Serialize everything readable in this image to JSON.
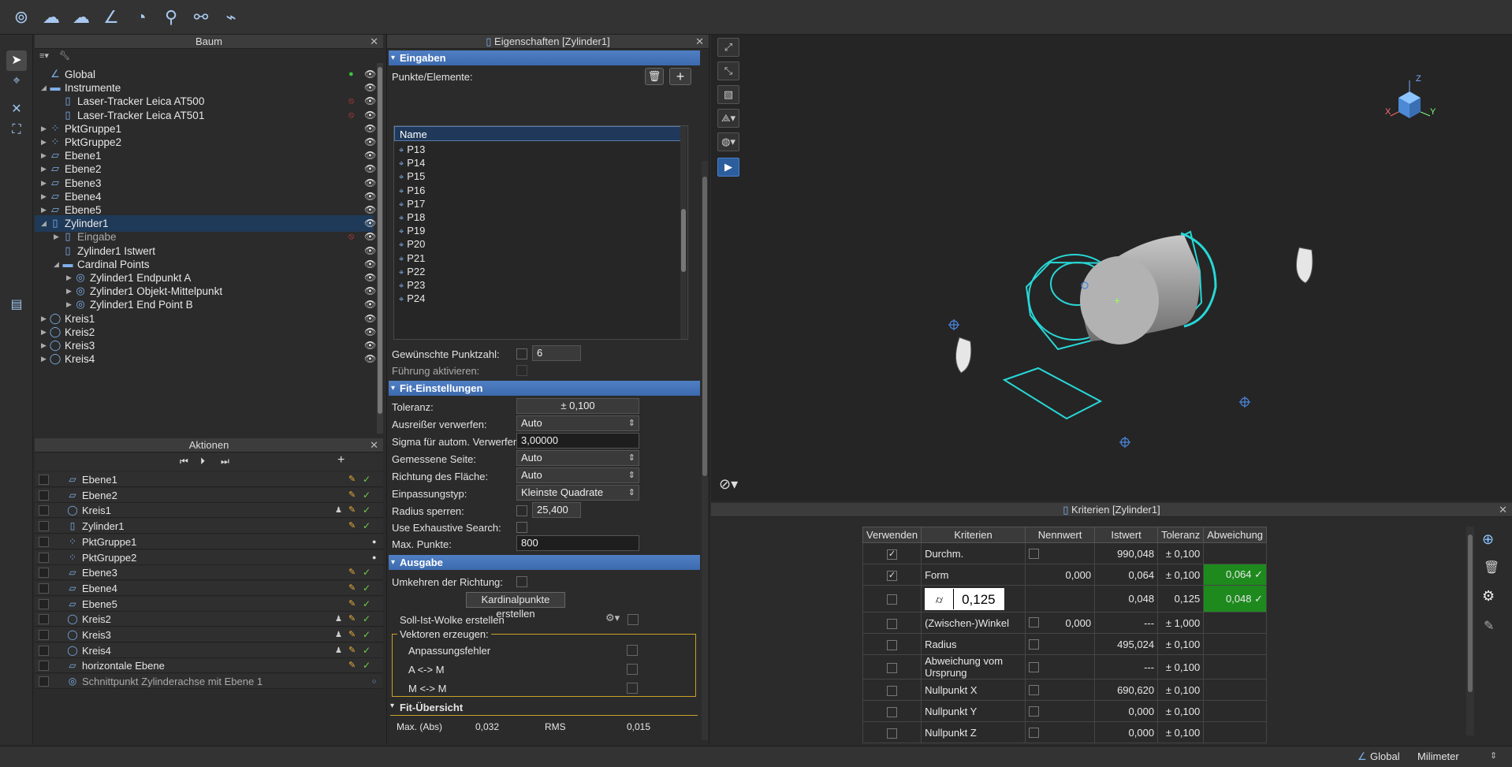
{
  "toolbar": {
    "icons": [
      "fit-circle-icon",
      "fit-cloud-icon",
      "fit-cloud2-icon",
      "fit-axis-icon",
      "fit-arc-icon",
      "fit-person-icon",
      "fit-link-icon",
      "fit-graph-icon"
    ]
  },
  "tree": {
    "title": "Baum",
    "items": [
      {
        "label": "Global",
        "level": 0,
        "arrow": "",
        "icon": "∠",
        "mark": "●",
        "mark_color": "#3cc43c"
      },
      {
        "label": "Instrumente",
        "level": 0,
        "arrow": "◢",
        "icon": "▬",
        "mark": ""
      },
      {
        "label": "Laser-Tracker Leica AT500",
        "level": 1,
        "arrow": "",
        "icon": "▯",
        "mark": "⦸",
        "mark_color": "#d04040"
      },
      {
        "label": "Laser-Tracker Leica AT501",
        "level": 1,
        "arrow": "",
        "icon": "▯",
        "mark": "⦸",
        "mark_color": "#d04040"
      },
      {
        "label": "PktGruppe1",
        "level": 0,
        "arrow": "▶",
        "icon": "⁘",
        "mark": ""
      },
      {
        "label": "PktGruppe2",
        "level": 0,
        "arrow": "▶",
        "icon": "⁘",
        "mark": ""
      },
      {
        "label": "Ebene1",
        "level": 0,
        "arrow": "▶",
        "icon": "▱",
        "mark": ""
      },
      {
        "label": "Ebene2",
        "level": 0,
        "arrow": "▶",
        "icon": "▱",
        "mark": ""
      },
      {
        "label": "Ebene3",
        "level": 0,
        "arrow": "▶",
        "icon": "▱",
        "mark": ""
      },
      {
        "label": "Ebene4",
        "level": 0,
        "arrow": "▶",
        "icon": "▱",
        "mark": ""
      },
      {
        "label": "Ebene5",
        "level": 0,
        "arrow": "▶",
        "icon": "▱",
        "mark": ""
      },
      {
        "label": "Zylinder1",
        "level": 0,
        "arrow": "◢",
        "icon": "▯",
        "mark": "",
        "selected": true
      },
      {
        "label": "Eingabe",
        "level": 1,
        "arrow": "▶",
        "icon": "▯",
        "mark": "⦸",
        "mark_color": "#d04040",
        "dim": true
      },
      {
        "label": "Zylinder1 Istwert",
        "level": 1,
        "arrow": "",
        "icon": "▯",
        "mark": ""
      },
      {
        "label": "Cardinal Points",
        "level": 1,
        "arrow": "◢",
        "icon": "▬",
        "mark": ""
      },
      {
        "label": "Zylinder1 Endpunkt A",
        "level": 2,
        "arrow": "▶",
        "icon": "◎",
        "mark": ""
      },
      {
        "label": "Zylinder1 Objekt-Mittelpunkt",
        "level": 2,
        "arrow": "▶",
        "icon": "◎",
        "mark": ""
      },
      {
        "label": "Zylinder1 End Point B",
        "level": 2,
        "arrow": "▶",
        "icon": "◎",
        "mark": ""
      },
      {
        "label": "Kreis1",
        "level": 0,
        "arrow": "▶",
        "icon": "◯",
        "mark": ""
      },
      {
        "label": "Kreis2",
        "level": 0,
        "arrow": "▶",
        "icon": "◯",
        "mark": ""
      },
      {
        "label": "Kreis3",
        "level": 0,
        "arrow": "▶",
        "icon": "◯",
        "mark": ""
      },
      {
        "label": "Kreis4",
        "level": 0,
        "arrow": "▶",
        "icon": "◯",
        "mark": ""
      }
    ]
  },
  "actions": {
    "title": "Aktionen",
    "items": [
      {
        "label": "Ebene1",
        "icon": "▱",
        "pers": false,
        "pen": true,
        "status": "✓",
        "dot": false
      },
      {
        "label": "Ebene2",
        "icon": "▱",
        "pers": false,
        "pen": true,
        "status": "✓",
        "dot": false
      },
      {
        "label": "Kreis1",
        "icon": "◯",
        "pers": true,
        "pen": true,
        "status": "✓",
        "dot": false
      },
      {
        "label": "Zylinder1",
        "icon": "▯",
        "pers": false,
        "pen": true,
        "status": "✓",
        "dot": false
      },
      {
        "label": "PktGruppe1",
        "icon": "⁘",
        "pers": false,
        "pen": false,
        "status": "",
        "dot": true
      },
      {
        "label": "PktGruppe2",
        "icon": "⁘",
        "pers": false,
        "pen": false,
        "status": "",
        "dot": true
      },
      {
        "label": "Ebene3",
        "icon": "▱",
        "pers": false,
        "pen": true,
        "status": "✓",
        "dot": false
      },
      {
        "label": "Ebene4",
        "icon": "▱",
        "pers": false,
        "pen": true,
        "status": "✓",
        "dot": false
      },
      {
        "label": "Ebene5",
        "icon": "▱",
        "pers": false,
        "pen": true,
        "status": "✓",
        "dot": false
      },
      {
        "label": "Kreis2",
        "icon": "◯",
        "pers": true,
        "pen": true,
        "status": "✓",
        "dot": false
      },
      {
        "label": "Kreis3",
        "icon": "◯",
        "pers": true,
        "pen": true,
        "status": "✓",
        "dot": false
      },
      {
        "label": "Kreis4",
        "icon": "◯",
        "pers": true,
        "pen": true,
        "status": "✓",
        "dot": false
      },
      {
        "label": "horizontale Ebene",
        "icon": "▱",
        "pers": false,
        "pen": true,
        "status": "✓",
        "dot": false
      },
      {
        "label": "Schnittpunkt Zylinderachse mit Ebene 1",
        "icon": "◎",
        "pers": false,
        "pen": false,
        "status": "",
        "dot": false,
        "dim": true,
        "ring": true
      }
    ]
  },
  "props": {
    "title": "Eigenschaften [Zylinder1]",
    "eingaben": "Eingaben",
    "punkte_label": "Punkte/Elemente:",
    "list_header": "Name",
    "points": [
      "P13",
      "P14",
      "P15",
      "P16",
      "P17",
      "P18",
      "P19",
      "P20",
      "P21",
      "P22",
      "P23",
      "P24"
    ],
    "gew_label": "Gewünschte Punktzahl:",
    "gew_value": "6",
    "fuehrung_label": "Führung aktivieren:",
    "fit_header": "Fit-Einstellungen",
    "toleranz_label": "Toleranz:",
    "toleranz_value": "± 0,100",
    "ausreisser_label": "Ausreißer verwerfen:",
    "ausreisser_value": "Auto",
    "sigma_label": "Sigma für autom. Verwerfen:",
    "sigma_value": "3,00000",
    "seite_label": "Gemessene Seite:",
    "seite_value": "Auto",
    "richtung_label": "Richtung des Fläche:",
    "richtung_value": "Auto",
    "typ_label": "Einpassungstyp:",
    "typ_value": "Kleinste Quadrate",
    "radius_label": "Radius sperren:",
    "radius_value": "25,400",
    "exhaustive_label": "Use Exhaustive Search:",
    "maxp_label": "Max. Punkte:",
    "maxp_value": "800",
    "ausgabe_header": "Ausgabe",
    "umkehren_label": "Umkehren der Richtung:",
    "kardinal_btn": "Kardinalpunkte erstellen",
    "soll_label": "Soll-Ist-Wolke erstellen",
    "vektoren_label": "Vektoren erzeugen:",
    "vec1": "Anpassungsfehler",
    "vec2": "A <-> M",
    "vec3": "M <-> M",
    "fituebersicht": "Fit-Übersicht",
    "maxabs_label": "Max. (Abs)",
    "maxabs_value": "0,032",
    "rms_label": "RMS",
    "rms_value": "0,015"
  },
  "viewport": {
    "axis_x": "X",
    "axis_y": "Y",
    "axis_z": "Z"
  },
  "criteria": {
    "title": "Kriterien [Zylinder1]",
    "headers": [
      "Verwenden",
      "Kriterien",
      "Nennwert",
      "Istwert",
      "Toleranz",
      "Abweichung"
    ],
    "rows": [
      {
        "use": true,
        "name": "Durchm.",
        "nenn_cb": true,
        "nenn": "",
        "ist": "990,048",
        "tol": "± 0,100",
        "abw": "",
        "ok": false
      },
      {
        "use": true,
        "name": "Form",
        "nenn_cb": false,
        "nenn": "0,000",
        "ist": "0,064",
        "tol": "± 0,100",
        "abw": "0,064 ✓",
        "ok": true
      },
      {
        "use": false,
        "name": "",
        "gdt": true,
        "gdt_value": "0,125",
        "nenn_cb": false,
        "nenn": "",
        "ist": "0,048",
        "tol": "0,125",
        "abw": "0,048 ✓",
        "ok": true
      },
      {
        "use": false,
        "name": "(Zwischen-)Winkel",
        "nenn_cb": true,
        "nenn": "0,000",
        "ist": "---",
        "tol": "± 1,000",
        "abw": "",
        "ok": false
      },
      {
        "use": false,
        "name": "Radius",
        "nenn_cb": true,
        "nenn": "",
        "ist": "495,024",
        "tol": "± 0,100",
        "abw": "",
        "ok": false
      },
      {
        "use": false,
        "name": "Abweichung vom Ursprung",
        "nenn_cb": true,
        "nenn": "",
        "ist": "---",
        "tol": "± 0,100",
        "abw": "",
        "ok": false
      },
      {
        "use": false,
        "name": "Nullpunkt X",
        "nenn_cb": true,
        "nenn": "",
        "ist": "690,620",
        "tol": "± 0,100",
        "abw": "",
        "ok": false
      },
      {
        "use": false,
        "name": "Nullpunkt Y",
        "nenn_cb": true,
        "nenn": "",
        "ist": "0,000",
        "tol": "± 0,100",
        "abw": "",
        "ok": false
      },
      {
        "use": false,
        "name": "Nullpunkt Z",
        "nenn_cb": true,
        "nenn": "",
        "ist": "0,000",
        "tol": "± 0,100",
        "abw": "",
        "ok": false
      }
    ]
  },
  "status": {
    "coord": "Global",
    "unit": "Milimeter"
  }
}
